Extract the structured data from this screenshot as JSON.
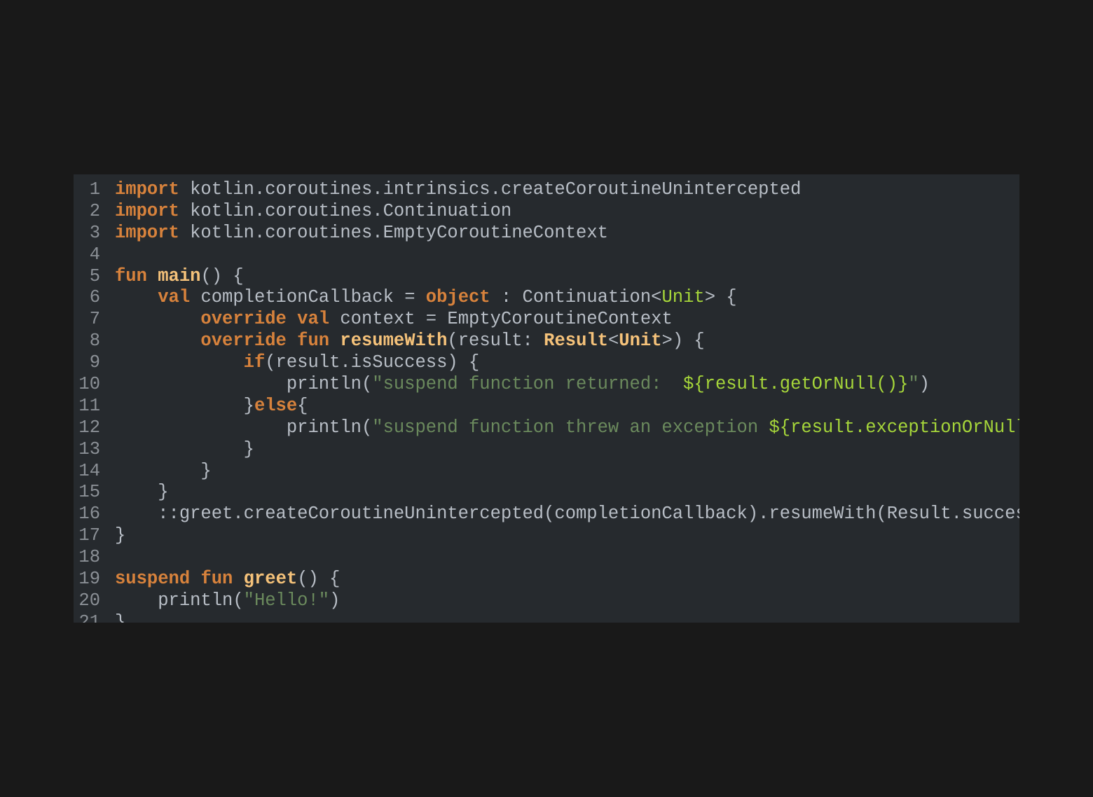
{
  "colors": {
    "page_background": "#191919",
    "editor_background": "#262a2e",
    "keyword": "#d7823c",
    "function_name": "#f5c27a",
    "type": "#a6d63a",
    "string": "#6b8a5d",
    "interpolation": "#a6d63a",
    "plain": "#b8bec6",
    "line_number": "#8b9096"
  },
  "editor": {
    "language": "kotlin",
    "lines": [
      {
        "n": "1",
        "tokens": [
          {
            "t": "kw",
            "v": "import"
          },
          {
            "t": "plain",
            "v": " kotlin.coroutines.intrinsics.createCoroutineUnintercepted"
          }
        ]
      },
      {
        "n": "2",
        "tokens": [
          {
            "t": "kw",
            "v": "import"
          },
          {
            "t": "plain",
            "v": " kotlin.coroutines.Continuation"
          }
        ]
      },
      {
        "n": "3",
        "tokens": [
          {
            "t": "kw",
            "v": "import"
          },
          {
            "t": "plain",
            "v": " kotlin.coroutines.EmptyCoroutineContext"
          }
        ]
      },
      {
        "n": "4",
        "tokens": []
      },
      {
        "n": "5",
        "tokens": [
          {
            "t": "kw",
            "v": "fun"
          },
          {
            "t": "plain",
            "v": " "
          },
          {
            "t": "fn",
            "v": "main"
          },
          {
            "t": "plain",
            "v": "() {"
          }
        ]
      },
      {
        "n": "6",
        "tokens": [
          {
            "t": "plain",
            "v": "    "
          },
          {
            "t": "kw",
            "v": "val"
          },
          {
            "t": "plain",
            "v": " completionCallback = "
          },
          {
            "t": "kw",
            "v": "object"
          },
          {
            "t": "plain",
            "v": " : Continuation<"
          },
          {
            "t": "type",
            "v": "Unit"
          },
          {
            "t": "plain",
            "v": "> {"
          }
        ]
      },
      {
        "n": "7",
        "tokens": [
          {
            "t": "plain",
            "v": "        "
          },
          {
            "t": "kw",
            "v": "override"
          },
          {
            "t": "plain",
            "v": " "
          },
          {
            "t": "kw",
            "v": "val"
          },
          {
            "t": "plain",
            "v": " context = EmptyCoroutineContext"
          }
        ]
      },
      {
        "n": "8",
        "tokens": [
          {
            "t": "plain",
            "v": "        "
          },
          {
            "t": "kw",
            "v": "override"
          },
          {
            "t": "plain",
            "v": " "
          },
          {
            "t": "kw",
            "v": "fun"
          },
          {
            "t": "plain",
            "v": " "
          },
          {
            "t": "fn",
            "v": "resumeWith"
          },
          {
            "t": "plain",
            "v": "(result: "
          },
          {
            "t": "typeb",
            "v": "Result"
          },
          {
            "t": "plain",
            "v": "<"
          },
          {
            "t": "typeb",
            "v": "Unit"
          },
          {
            "t": "plain",
            "v": ">) {"
          }
        ]
      },
      {
        "n": "9",
        "tokens": [
          {
            "t": "plain",
            "v": "            "
          },
          {
            "t": "kw",
            "v": "if"
          },
          {
            "t": "plain",
            "v": "(result.isSuccess) {"
          }
        ]
      },
      {
        "n": "10",
        "tokens": [
          {
            "t": "plain",
            "v": "                println("
          },
          {
            "t": "str",
            "v": "\"suspend function returned:  "
          },
          {
            "t": "interp",
            "v": "${result.getOrNull()}"
          },
          {
            "t": "str",
            "v": "\""
          },
          {
            "t": "plain",
            "v": ")"
          }
        ]
      },
      {
        "n": "11",
        "tokens": [
          {
            "t": "plain",
            "v": "            }"
          },
          {
            "t": "kw",
            "v": "else"
          },
          {
            "t": "plain",
            "v": "{"
          }
        ]
      },
      {
        "n": "12",
        "tokens": [
          {
            "t": "plain",
            "v": "                println("
          },
          {
            "t": "str",
            "v": "\"suspend function threw an exception "
          },
          {
            "t": "interp",
            "v": "${result.exceptionOrNull()}"
          },
          {
            "t": "str",
            "v": "\""
          },
          {
            "t": "plain",
            "v": ")"
          }
        ]
      },
      {
        "n": "13",
        "tokens": [
          {
            "t": "plain",
            "v": "            }"
          }
        ]
      },
      {
        "n": "14",
        "tokens": [
          {
            "t": "plain",
            "v": "        }"
          }
        ]
      },
      {
        "n": "15",
        "tokens": [
          {
            "t": "plain",
            "v": "    }"
          }
        ]
      },
      {
        "n": "16",
        "tokens": [
          {
            "t": "plain",
            "v": "    ::greet.createCoroutineUnintercepted(completionCallback).resumeWith(Result.success(Unit))"
          }
        ]
      },
      {
        "n": "17",
        "tokens": [
          {
            "t": "plain",
            "v": "}"
          }
        ]
      },
      {
        "n": "18",
        "tokens": []
      },
      {
        "n": "19",
        "tokens": [
          {
            "t": "kw",
            "v": "suspend"
          },
          {
            "t": "plain",
            "v": " "
          },
          {
            "t": "kw",
            "v": "fun"
          },
          {
            "t": "plain",
            "v": " "
          },
          {
            "t": "fn",
            "v": "greet"
          },
          {
            "t": "plain",
            "v": "() {"
          }
        ]
      },
      {
        "n": "20",
        "tokens": [
          {
            "t": "plain",
            "v": "    println("
          },
          {
            "t": "str",
            "v": "\"Hello!\""
          },
          {
            "t": "plain",
            "v": ")"
          }
        ]
      },
      {
        "n": "21",
        "tokens": [
          {
            "t": "plain",
            "v": "}"
          }
        ]
      }
    ]
  }
}
